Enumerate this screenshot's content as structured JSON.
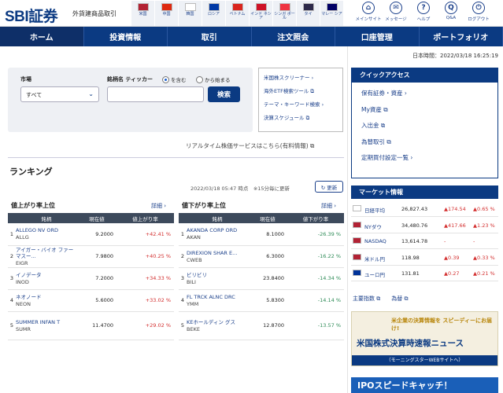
{
  "header": {
    "logo": "SBI証券",
    "subtitle": "外貨建商品取引",
    "countries": [
      {
        "label": "米国",
        "color": "#b22234",
        "icon": "us-flag"
      },
      {
        "label": "中国",
        "color": "#de2910",
        "icon": "china-flag"
      },
      {
        "label": "韓国",
        "color": "#ffffff",
        "icon": "korea-flag"
      },
      {
        "label": "ロシア",
        "color": "#0039a6",
        "icon": "russia-flag"
      },
      {
        "label": "ベトナム",
        "color": "#da251d",
        "icon": "vietnam-flag"
      },
      {
        "label": "インド ネシア",
        "color": "#ce1126",
        "icon": "indonesia-flag"
      },
      {
        "label": "シンガ ポール",
        "color": "#ef3340",
        "icon": "singapore-flag"
      },
      {
        "label": "タイ",
        "color": "#2d2a4a",
        "icon": "thailand-flag"
      },
      {
        "label": "マレー シア",
        "color": "#010066",
        "icon": "malaysia-flag"
      }
    ],
    "utilities": [
      {
        "label": "メインサイト",
        "icon": "home-icon",
        "glyph": "⌂"
      },
      {
        "label": "メッセージ",
        "icon": "message-icon",
        "glyph": "✉"
      },
      {
        "label": "ヘルプ",
        "icon": "help-icon",
        "glyph": "?"
      },
      {
        "label": "Q&A",
        "icon": "qa-icon",
        "glyph": "Q"
      },
      {
        "label": "ログアウト",
        "icon": "logout-icon",
        "glyph": "⏻"
      }
    ]
  },
  "nav": [
    "ホーム",
    "投資情報",
    "取引",
    "注文照会",
    "口座管理",
    "ポートフォリオ"
  ],
  "japan_time": "日本時間：2022/03/18 16:25:19",
  "search": {
    "market_label": "市場",
    "market_value": "すべて",
    "symbol_label": "銘柄名 ティッカー",
    "radio_contains": "を含む",
    "radio_starts": "から始まる",
    "button": "検索"
  },
  "side_links": [
    "米国株スクリーナー ›",
    "海外ETF検索ツール ⧉",
    "テーマ・キーワード検索 ›",
    "決算スケジュール ⧉"
  ],
  "realtime_link": "リアルタイム株価サービスはこちら(有料情報) ⧉",
  "ranking": {
    "title": "ランキング",
    "date": "2022/03/18 05:47 時点　※15分毎に更新",
    "update_button": "↻ 更新",
    "detail": "詳細 ›",
    "gainers_title": "値上がり率上位",
    "losers_title": "値下がり率上位",
    "columns_gain": [
      "銘柄",
      "現在値",
      "値上がり率"
    ],
    "columns_loss": [
      "銘柄",
      "現在値",
      "値下がり率"
    ],
    "gainers": [
      {
        "rank": "1",
        "name": "ALLEGO NV ORD",
        "code": "ALLG",
        "price": "9.2000",
        "pct": "+42.41 %"
      },
      {
        "rank": "2",
        "name": "アイガー・バイオ ファーマスー...",
        "code": "EIGR",
        "price": "7.9800",
        "pct": "+40.25 %"
      },
      {
        "rank": "3",
        "name": "イノデータ",
        "code": "INOD",
        "price": "7.2000",
        "pct": "+34.33 %"
      },
      {
        "rank": "4",
        "name": "ネオノード",
        "code": "NEON",
        "price": "5.6000",
        "pct": "+33.02 %"
      },
      {
        "rank": "5",
        "name": "SUMMER INFAN T",
        "code": "SUMR",
        "price": "11.4700",
        "pct": "+29.02 %"
      }
    ],
    "losers": [
      {
        "rank": "1",
        "name": "AKANDA CORP ORD",
        "code": "AKAN",
        "price": "8.1000",
        "pct": "-26.39 %"
      },
      {
        "rank": "2",
        "name": "DIREXION SHAR E...",
        "code": "CWEB",
        "price": "6.3000",
        "pct": "-16.22 %"
      },
      {
        "rank": "3",
        "name": "ビリビリ",
        "code": "BILI",
        "price": "23.8400",
        "pct": "-14.34 %"
      },
      {
        "rank": "4",
        "name": "FL TRCK ALNC DRC",
        "code": "YMM",
        "price": "5.8300",
        "pct": "-14.14 %"
      },
      {
        "rank": "5",
        "name": "KEホールディン グス",
        "code": "BEKE",
        "price": "12.8700",
        "pct": "-13.57 %"
      }
    ]
  },
  "quick_access": {
    "title": "クイックアクセス",
    "items": [
      "保有証券・資産 ›",
      "My資産 ⧉",
      "入出金 ⧉",
      "為替取引 ⧉",
      "定期買付設定一覧 ›"
    ]
  },
  "market": {
    "title": "マーケット情報",
    "rows": [
      {
        "name": "日経平均",
        "value": "26,827.43",
        "chg": "▲174.54",
        "pct": "▲0.65 %",
        "flag": "#ffffff"
      },
      {
        "name": "NYダウ",
        "value": "34,480.76",
        "chg": "▲417.66",
        "pct": "▲1.23 %",
        "flag": "#b22234"
      },
      {
        "name": "NASDAQ",
        "value": "13,614.78",
        "chg": "-",
        "pct": "-",
        "flag": "#b22234"
      },
      {
        "name": "米ドル円",
        "value": "118.98",
        "chg": "▲0.39",
        "pct": "▲0.33 %",
        "flag": "#b22234"
      },
      {
        "name": "ユーロ円",
        "value": "131.81",
        "chg": "▲0.27",
        "pct": "▲0.21 %",
        "flag": "#003399"
      }
    ],
    "links": "主要指数 ⧉　　為替 ⧉"
  },
  "banner1": {
    "top": "米企業の決算情報を スピーディーにお届け!",
    "main": "米国株式決算時速報ニュース",
    "sub": "（モーニングスターWEBサイトへ）"
  },
  "banner2": "IPOスピードキャッチ！"
}
